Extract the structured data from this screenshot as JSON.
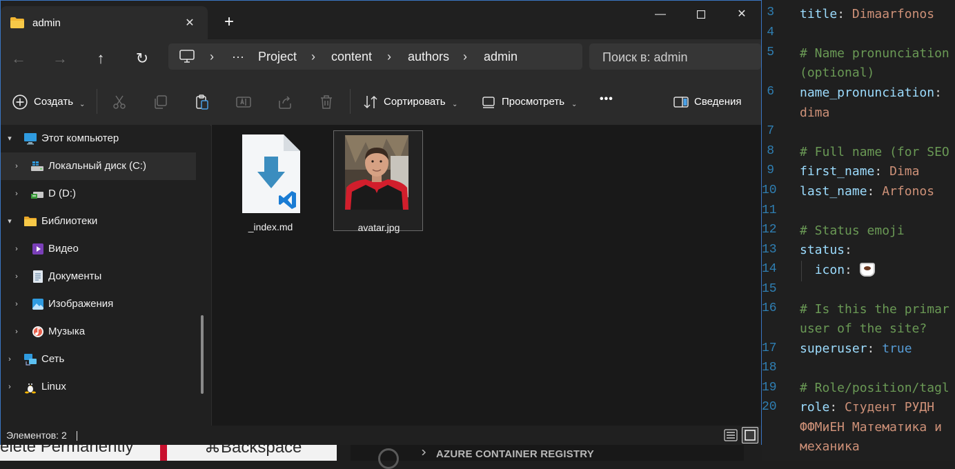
{
  "window": {
    "tab_title": "admin",
    "tab_close_icon": "close-icon",
    "new_tab_icon": "plus-icon"
  },
  "nav": {
    "breadcrumb": [
      "Project",
      "content",
      "authors",
      "admin"
    ],
    "overflow_label": "···",
    "search_placeholder": "Поиск в: admin"
  },
  "toolbar": {
    "create_label": "Создать",
    "sort_label": "Сортировать",
    "view_label": "Просмотреть",
    "more_label": "•••",
    "details_label": "Сведения"
  },
  "sidebar": {
    "items": [
      {
        "label": "Этот компьютер",
        "icon": "monitor-icon"
      },
      {
        "label": "Локальный диск (C:)",
        "icon": "drive-c-icon"
      },
      {
        "label": "D (D:)",
        "icon": "drive-d-icon"
      },
      {
        "label": "Библиотеки",
        "icon": "folder-icon"
      },
      {
        "label": "Видео",
        "icon": "video-icon"
      },
      {
        "label": "Документы",
        "icon": "documents-icon"
      },
      {
        "label": "Изображения",
        "icon": "images-icon"
      },
      {
        "label": "Музыка",
        "icon": "music-icon"
      },
      {
        "label": "Сеть",
        "icon": "network-icon"
      },
      {
        "label": "Linux",
        "icon": "linux-icon"
      }
    ]
  },
  "files": [
    {
      "name": "_index.md",
      "icon": "markdown-file-icon"
    },
    {
      "name": "avatar.jpg",
      "icon": "image-thumbnail"
    }
  ],
  "status": {
    "count_text": "Элементов: 2"
  },
  "editor": {
    "line_numbers": [
      "3",
      "4",
      "5",
      "6",
      "7",
      "8",
      "9",
      "10",
      "11",
      "12",
      "13",
      "14",
      "15",
      "16",
      "17",
      "18",
      "19",
      "20"
    ],
    "lines": [
      {
        "k": "title",
        "v": "Dimaarfonos"
      },
      {
        "c": "# Name pronunciation"
      },
      {
        "c": "(optional)"
      },
      {
        "k": "name_pronunciation",
        "v": ""
      },
      {
        "v2": "dima"
      },
      {
        "c": "# Full name (for SEO"
      },
      {
        "k": "first_name",
        "v": "Dima"
      },
      {
        "k": "last_name",
        "v": "Arfonos"
      },
      {
        "c": "# Status emoji"
      },
      {
        "k": "status",
        "v": ""
      },
      {
        "k": "icon",
        "v": ""
      },
      {
        "c": "# Is this the primar"
      },
      {
        "c": "user of the site?"
      },
      {
        "k": "superuser",
        "b": "true"
      },
      {
        "c": "# Role/position/tagl"
      },
      {
        "k": "role",
        "v": "Студент РУДН"
      },
      {
        "v2": "ФФМиЕН Математика и"
      },
      {
        "v2": "механика"
      }
    ]
  },
  "bottom": {
    "azure_label": "AZURE CONTAINER REGISTRY",
    "shortcut_left": "elete Permanently",
    "shortcut_right": "⌘Backspace"
  },
  "colors": {
    "accent": "#3a76c4",
    "vscode_blue": "#007acc"
  }
}
